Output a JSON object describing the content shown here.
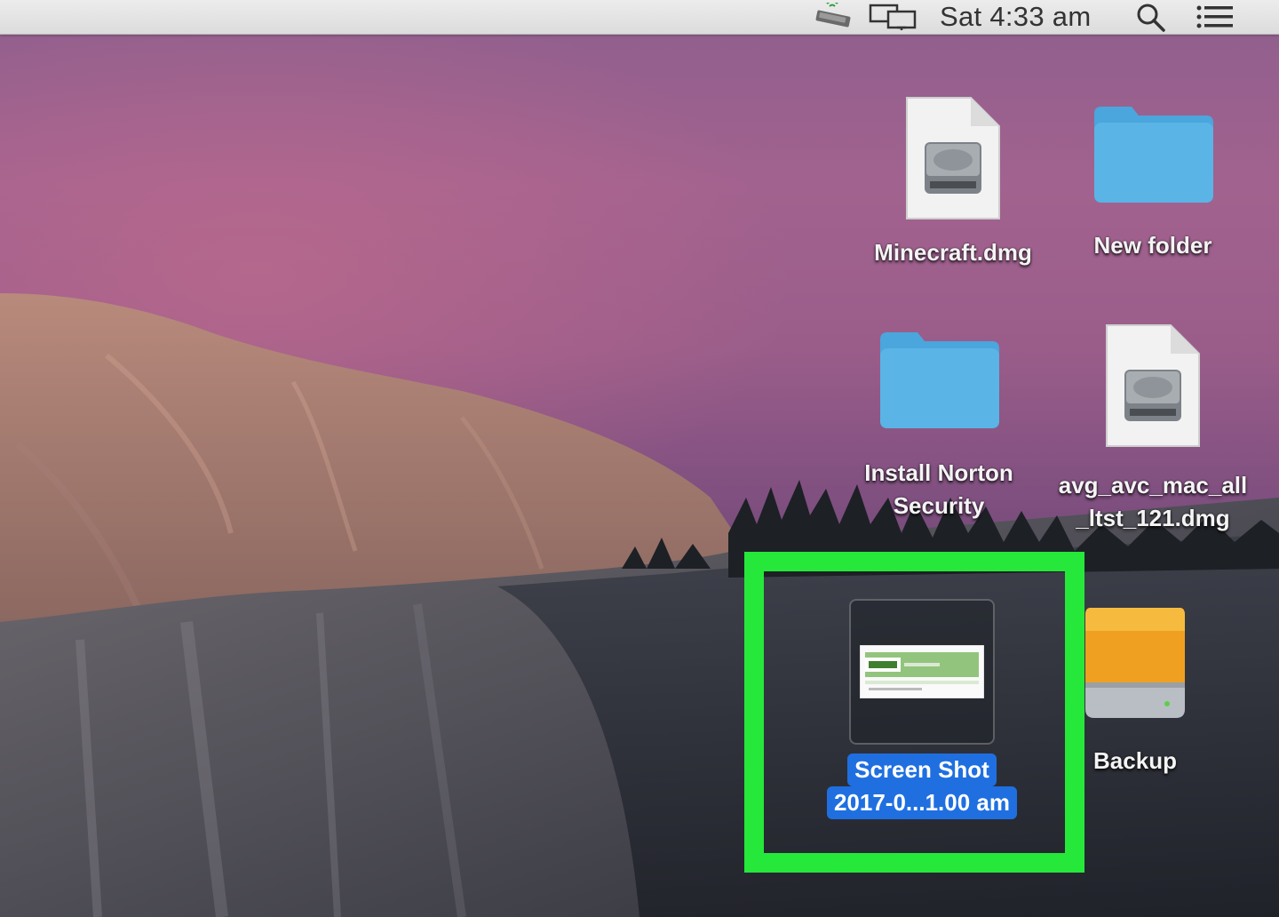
{
  "menubar": {
    "clock": "Sat 4:33 am",
    "icons": [
      "usb-drive-icon",
      "display-mirroring-icon",
      "search-icon",
      "notification-center-icon"
    ]
  },
  "desktop": {
    "icons": [
      {
        "name": "Minecraft.dmg",
        "type": "disk-image"
      },
      {
        "name": "New folder",
        "type": "folder"
      },
      {
        "name_lines": [
          "Install Norton",
          "Security"
        ],
        "type": "folder"
      },
      {
        "name_lines": [
          "avg_avc_mac_all",
          "_ltst_121.dmg"
        ],
        "type": "disk-image"
      },
      {
        "name_lines": [
          "Screen Shot",
          "2017-0...1.00 am"
        ],
        "type": "screenshot",
        "selected": true
      },
      {
        "name": "Backup",
        "type": "external-drive"
      }
    ]
  },
  "colors": {
    "highlight": "#25e83a",
    "selection": "#1f6fe0",
    "folder": "#5ab4e6",
    "drive": "#f0a020"
  }
}
